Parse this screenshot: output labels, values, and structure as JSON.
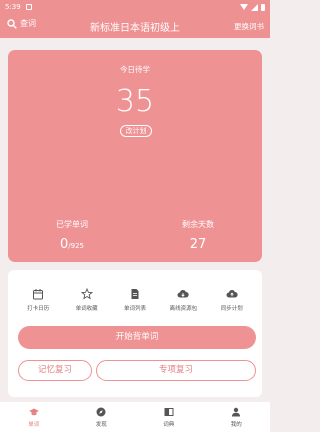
{
  "status_bar": {
    "time": "5:39"
  },
  "app_bar": {
    "search_label": "查词",
    "title": "新标准日本语初级上",
    "change_book_label": "更换词书"
  },
  "plan": {
    "today_label": "今日待学",
    "today_count": "35",
    "change_plan_label": "改计划",
    "learned_label": "已学单词",
    "learned_count": "0",
    "learned_total": "/925",
    "remaining_label": "剩余天数",
    "remaining_days": "27"
  },
  "tools": [
    {
      "label": "打卡日历",
      "icon": "calendar-icon"
    },
    {
      "label": "单词收藏",
      "icon": "star-icon"
    },
    {
      "label": "单词列表",
      "icon": "list-icon"
    },
    {
      "label": "离线资源包",
      "icon": "cloud-download-icon"
    },
    {
      "label": "同步计划",
      "icon": "cloud-upload-icon"
    }
  ],
  "actions": {
    "start_label": "开始背单词",
    "memory_review_label": "记忆复习",
    "special_review_label": "专项复习"
  },
  "bottom_nav": [
    {
      "label": "单词",
      "icon": "graduation-cap-icon",
      "active": true
    },
    {
      "label": "发现",
      "icon": "compass-icon",
      "active": false
    },
    {
      "label": "词典",
      "icon": "book-icon",
      "active": false
    },
    {
      "label": "我的",
      "icon": "person-icon",
      "active": false
    }
  ],
  "colors": {
    "primary": "#ef9294",
    "background": "#f4eded"
  }
}
